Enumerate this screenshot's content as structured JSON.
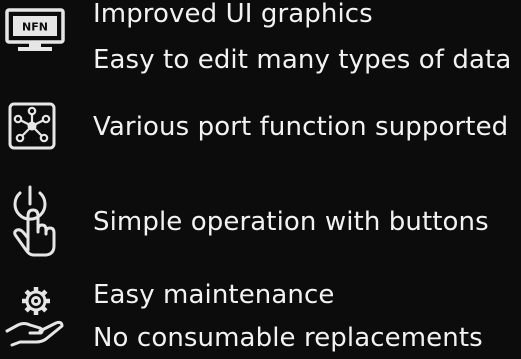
{
  "features": [
    {
      "icon": "monitor-icon",
      "icon_text": "NFN",
      "lines": [
        "Improved UI graphics",
        "Easy to edit many types of data"
      ]
    },
    {
      "icon": "network-hub-icon",
      "lines": [
        "Various port function supported"
      ]
    },
    {
      "icon": "touch-power-icon",
      "lines": [
        "Simple operation with buttons"
      ]
    },
    {
      "icon": "gear-hand-icon",
      "lines": [
        "Easy maintenance",
        "No consumable replacements"
      ]
    }
  ],
  "colors": {
    "background": "#0c0c0c",
    "text": "#f2f2f2",
    "icon": "#e6e6e6"
  }
}
